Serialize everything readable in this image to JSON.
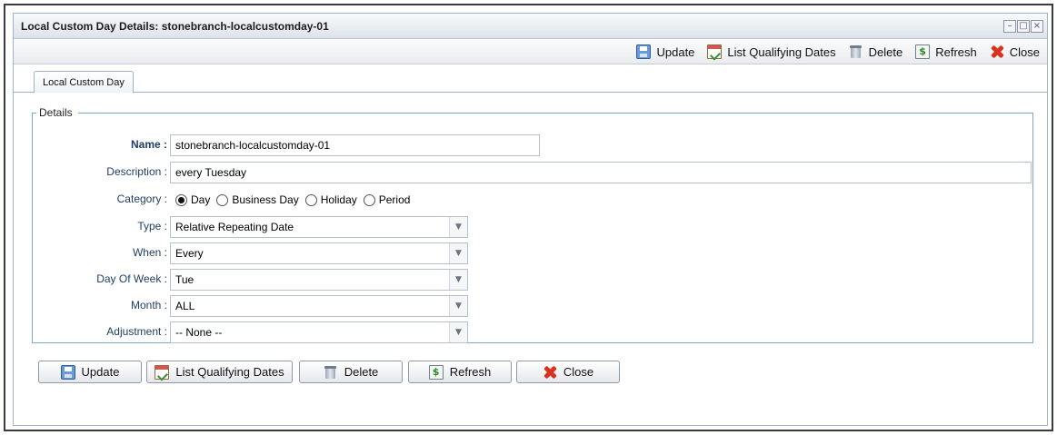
{
  "window": {
    "title": "Local Custom Day Details: stonebranch-localcustomday-01"
  },
  "toolbar": {
    "update_label": "Update",
    "list_qualifying_dates_label": "List Qualifying Dates",
    "delete_label": "Delete",
    "refresh_label": "Refresh",
    "close_label": "Close"
  },
  "tabs": [
    {
      "label": "Local Custom Day",
      "active": true
    }
  ],
  "details": {
    "legend": "Details",
    "name": {
      "label": "Name :",
      "value": "stonebranch-localcustomday-01"
    },
    "description": {
      "label": "Description :",
      "value": "every Tuesday"
    },
    "category": {
      "label": "Category :",
      "options": [
        "Day",
        "Business Day",
        "Holiday",
        "Period"
      ],
      "selected": "Day"
    },
    "type": {
      "label": "Type :",
      "value": "Relative Repeating Date"
    },
    "when": {
      "label": "When :",
      "value": "Every"
    },
    "day_of_week": {
      "label": "Day Of Week :",
      "value": "Tue"
    },
    "month": {
      "label": "Month :",
      "value": "ALL"
    },
    "adjustment": {
      "label": "Adjustment :",
      "value": "-- None --"
    }
  },
  "buttons": {
    "update_label": "Update",
    "list_qualifying_dates_label": "List Qualifying Dates",
    "delete_label": "Delete",
    "refresh_label": "Refresh",
    "close_label": "Close"
  },
  "icons": {
    "update": "save-icon",
    "list_qualifying_dates": "calendar-icon",
    "delete": "trash-icon",
    "refresh": "refresh-icon",
    "close": "close-icon"
  },
  "colors": {
    "label_text": "#1f3f64",
    "fieldset_border": "#7ea6c6",
    "close_icon": "#d9331f"
  }
}
